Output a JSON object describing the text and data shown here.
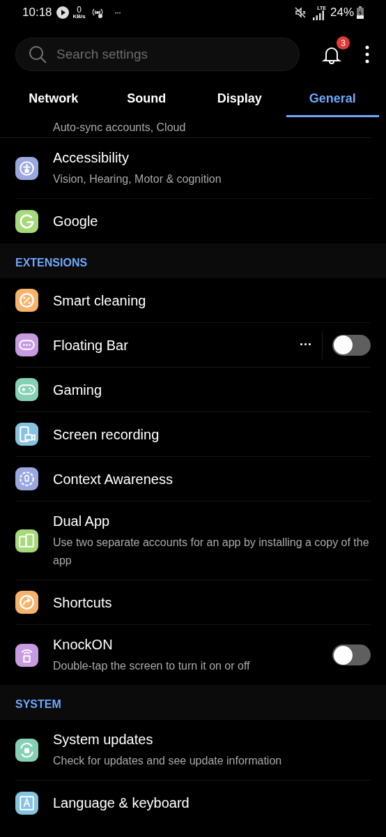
{
  "status_bar": {
    "time": "10:18",
    "speed_value": "0",
    "speed_unit": "KB/s",
    "network": "LTE",
    "battery": "24%"
  },
  "search": {
    "placeholder": "Search settings"
  },
  "notifications": {
    "count": "3"
  },
  "tabs": [
    {
      "label": "Network",
      "selected": false
    },
    {
      "label": "Sound",
      "selected": false
    },
    {
      "label": "Display",
      "selected": false
    },
    {
      "label": "General",
      "selected": true
    }
  ],
  "sections": [
    {
      "items": [
        {
          "kind": "partial",
          "subtitle": "Auto-sync accounts, Cloud"
        },
        {
          "kind": "item",
          "title": "Accessibility",
          "subtitle": "Vision, Hearing, Motor & cognition",
          "color": "#9aa8e0"
        },
        {
          "kind": "item",
          "title": "Google",
          "color": "#a6d97a"
        }
      ]
    },
    {
      "header": "EXTENSIONS",
      "items": [
        {
          "kind": "item",
          "title": "Smart cleaning",
          "color": "#f7b36b"
        },
        {
          "kind": "toggle",
          "title": "Floating Bar",
          "color": "#c79be0",
          "more": "···",
          "on": false
        },
        {
          "kind": "item",
          "title": "Gaming",
          "color": "#86d1b5"
        },
        {
          "kind": "item",
          "title": "Screen recording",
          "color": "#86c3e0"
        },
        {
          "kind": "item",
          "title": "Context Awareness",
          "color": "#9aa8e0"
        },
        {
          "kind": "item",
          "title": "Dual App",
          "subtitle": "Use two separate accounts for an app by installing a copy of the app",
          "color": "#a6d97a"
        },
        {
          "kind": "item",
          "title": "Shortcuts",
          "color": "#f7b36b"
        },
        {
          "kind": "toggle",
          "title": "KnockON",
          "subtitle": "Double-tap the screen to turn it on or off",
          "color": "#c79be0",
          "on": false
        }
      ]
    },
    {
      "header": "SYSTEM",
      "items": [
        {
          "kind": "item",
          "title": "System updates",
          "subtitle": "Check for updates and see update information",
          "color": "#86d1b5"
        },
        {
          "kind": "item",
          "title": "Language & keyboard",
          "color": "#86c3e0"
        }
      ]
    }
  ]
}
